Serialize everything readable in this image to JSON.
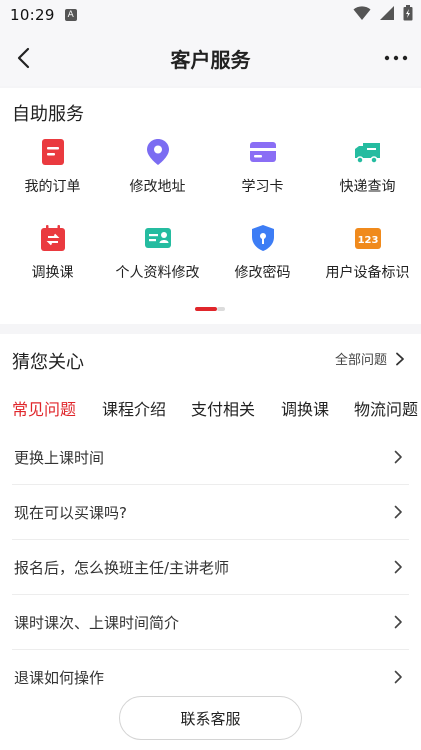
{
  "status_bar": {
    "time": "10:29",
    "badge": "A"
  },
  "header": {
    "title": "客户服务"
  },
  "self_service": {
    "title": "自助服务",
    "items": [
      {
        "label": "我的订单",
        "icon": "order-icon",
        "color": "#ea3a3f"
      },
      {
        "label": "修改地址",
        "icon": "location-pin-icon",
        "color": "#7b6cf2"
      },
      {
        "label": "学习卡",
        "icon": "card-icon",
        "color": "#8a6ef5"
      },
      {
        "label": "快递查询",
        "icon": "delivery-truck-icon",
        "color": "#25bca0"
      },
      {
        "label": "调换课",
        "icon": "calendar-swap-icon",
        "color": "#ea3a3f"
      },
      {
        "label": "个人资料修改",
        "icon": "profile-card-icon",
        "color": "#25bca0"
      },
      {
        "label": "修改密码",
        "icon": "shield-lock-icon",
        "color": "#3d7df5"
      },
      {
        "label": "用户设备标识",
        "icon": "device-id-icon",
        "color": "#f08a1c",
        "icon_text": "123"
      }
    ],
    "page_indicator": {
      "current": 1,
      "total": 2
    }
  },
  "guess": {
    "title": "猜您关心",
    "all_label": "全部问题",
    "tabs": [
      {
        "label": "常见问题",
        "active": true
      },
      {
        "label": "课程介绍",
        "active": false
      },
      {
        "label": "支付相关",
        "active": false
      },
      {
        "label": "调换课",
        "active": false
      },
      {
        "label": "物流问题",
        "active": false
      }
    ],
    "faq": [
      "更换上课时间",
      "现在可以买课吗?",
      "报名后，怎么换班主任/主讲老师",
      "课时课次、上课时间简介",
      "退课如何操作"
    ]
  },
  "footer": {
    "contact_label": "联系客服"
  },
  "colors": {
    "accent": "#e0262b"
  }
}
